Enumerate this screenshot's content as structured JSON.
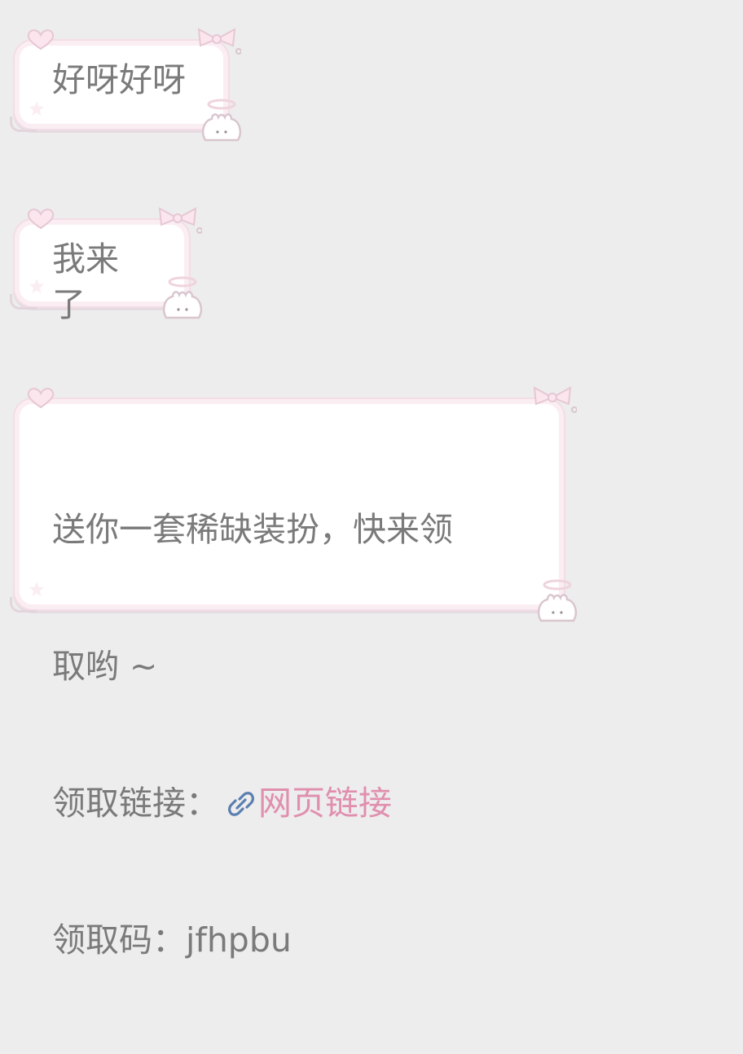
{
  "messages": [
    {
      "text": "好呀好呀"
    },
    {
      "text": "我来了"
    },
    {
      "lines": [
        "送你一套稀缺装扮，快来领",
        "取哟 ~"
      ],
      "link_label": "领取链接：",
      "link_text": "网页链接",
      "code_label": "领取码：",
      "code_value": "jfhpbu"
    }
  ],
  "colors": {
    "background": "#ededed",
    "bubble_fill": "#ffffff",
    "bubble_border": "#fbeef3",
    "text": "#7a7a7a",
    "link": "#e08fae",
    "link_icon": "#5b7fb0"
  }
}
